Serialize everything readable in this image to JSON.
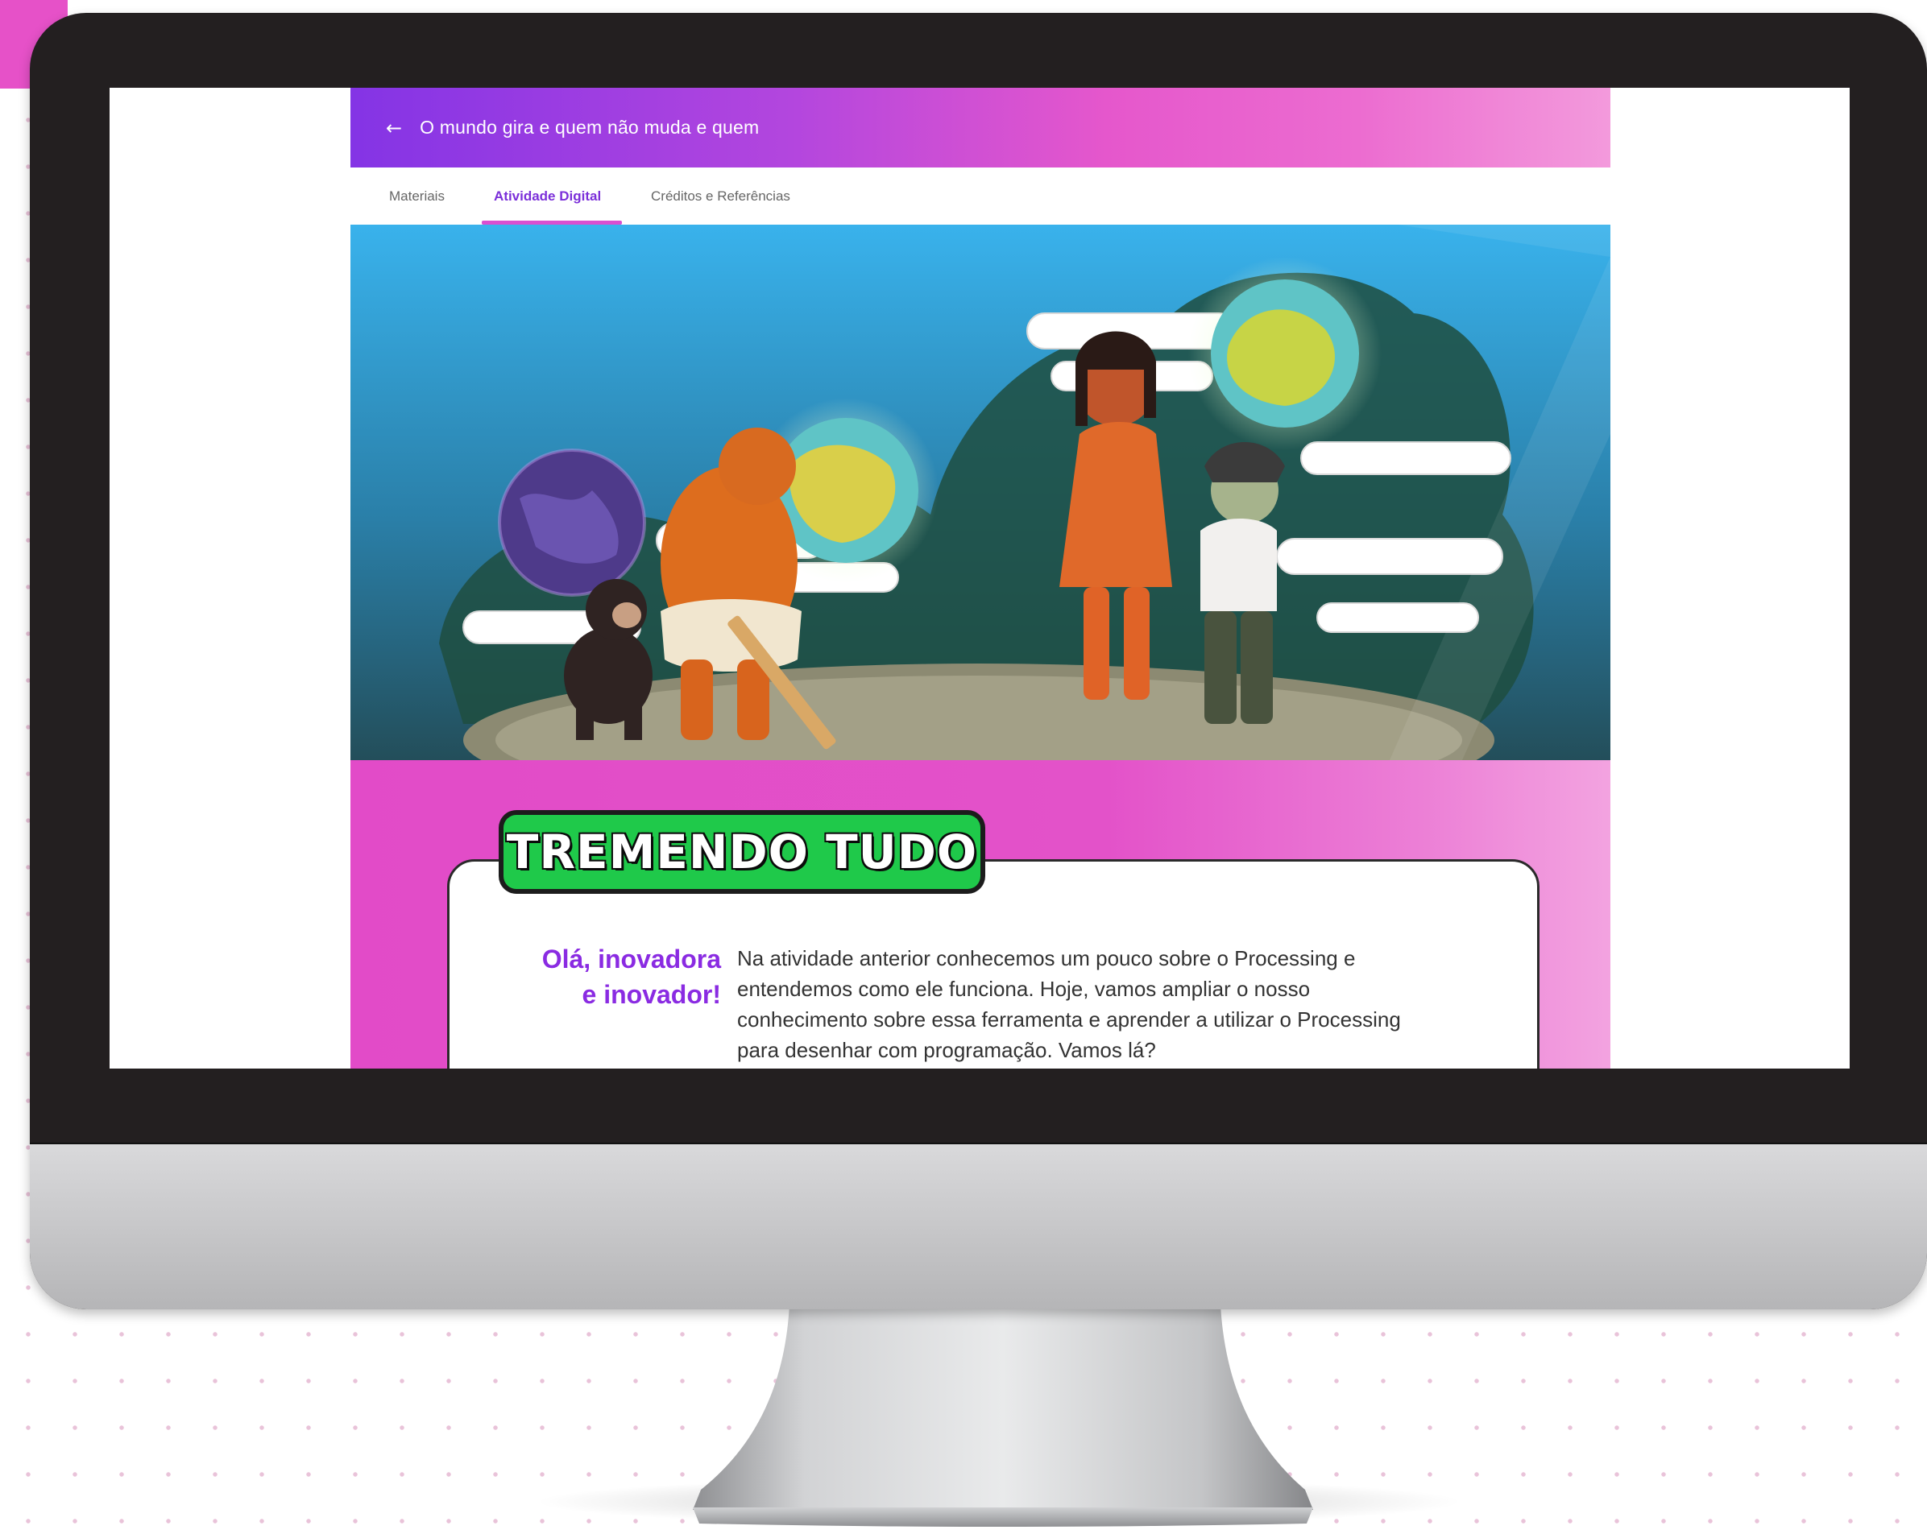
{
  "colors": {
    "accent_pink": "#e24bc8",
    "accent_purple": "#7b2fd9",
    "badge_green": "#1fc94a",
    "monitor_frame": "#231f20"
  },
  "header": {
    "back_icon": "←",
    "title": "O mundo gira e quem não muda e quem"
  },
  "tabs": [
    {
      "label": "Materiais",
      "active": false
    },
    {
      "label": "Atividade Digital",
      "active": true
    },
    {
      "label": "Créditos e Referências",
      "active": false
    }
  ],
  "hero": {
    "icon": "illustration-evolution-globes"
  },
  "activity": {
    "badge_title": "TREMENDO TUDO",
    "greeting_line1": "Olá, inovadora",
    "greeting_line2": "e inovador!",
    "intro_line1": "Na atividade anterior conhecemos um pouco sobre o Processing e",
    "intro_line2": "entendemos como ele funciona. Hoje, vamos ampliar o nosso",
    "intro_line3": "conhecimento sobre essa ferramenta e aprender a utilizar o Processing",
    "intro_line4": "para desenhar com programação. Vamos lá?"
  }
}
